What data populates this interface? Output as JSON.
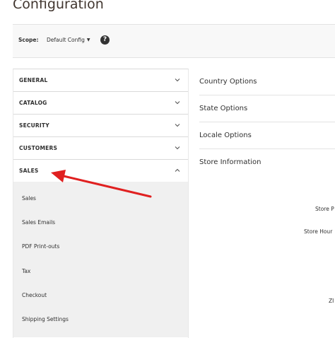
{
  "page": {
    "title": "Configuration"
  },
  "scope": {
    "label": "Scope:",
    "selected": "Default Config"
  },
  "sidebar": {
    "sections": [
      {
        "label": "GENERAL",
        "expanded": false
      },
      {
        "label": "CATALOG",
        "expanded": false
      },
      {
        "label": "SECURITY",
        "expanded": false
      },
      {
        "label": "CUSTOMERS",
        "expanded": false
      },
      {
        "label": "SALES",
        "expanded": true
      }
    ],
    "sales_items": [
      "Sales",
      "Sales Emails",
      "PDF Print-outs",
      "Tax",
      "Checkout",
      "Shipping Settings"
    ]
  },
  "main": {
    "groups": [
      "Country Options",
      "State Options",
      "Locale Options",
      "Store Information"
    ],
    "field_labels": [
      "Store P",
      "Store Hour",
      "ZI"
    ]
  },
  "annotation": {
    "arrow_color": "#e02020"
  },
  "colors": {
    "sub_bg": "#f0f0f0",
    "scope_bg": "#f8f8f8"
  }
}
